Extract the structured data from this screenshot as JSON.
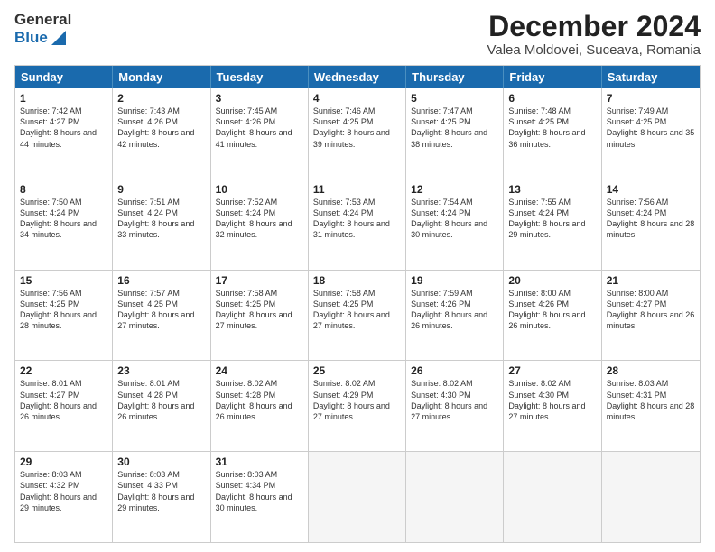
{
  "header": {
    "logo_general": "General",
    "logo_blue": "Blue",
    "month_title": "December 2024",
    "location": "Valea Moldovei, Suceava, Romania"
  },
  "days_of_week": [
    "Sunday",
    "Monday",
    "Tuesday",
    "Wednesday",
    "Thursday",
    "Friday",
    "Saturday"
  ],
  "weeks": [
    [
      {
        "day": 1,
        "sunrise": "7:42 AM",
        "sunset": "4:27 PM",
        "daylight": "8 hours and 44 minutes."
      },
      {
        "day": 2,
        "sunrise": "7:43 AM",
        "sunset": "4:26 PM",
        "daylight": "8 hours and 42 minutes."
      },
      {
        "day": 3,
        "sunrise": "7:45 AM",
        "sunset": "4:26 PM",
        "daylight": "8 hours and 41 minutes."
      },
      {
        "day": 4,
        "sunrise": "7:46 AM",
        "sunset": "4:25 PM",
        "daylight": "8 hours and 39 minutes."
      },
      {
        "day": 5,
        "sunrise": "7:47 AM",
        "sunset": "4:25 PM",
        "daylight": "8 hours and 38 minutes."
      },
      {
        "day": 6,
        "sunrise": "7:48 AM",
        "sunset": "4:25 PM",
        "daylight": "8 hours and 36 minutes."
      },
      {
        "day": 7,
        "sunrise": "7:49 AM",
        "sunset": "4:25 PM",
        "daylight": "8 hours and 35 minutes."
      }
    ],
    [
      {
        "day": 8,
        "sunrise": "7:50 AM",
        "sunset": "4:24 PM",
        "daylight": "8 hours and 34 minutes."
      },
      {
        "day": 9,
        "sunrise": "7:51 AM",
        "sunset": "4:24 PM",
        "daylight": "8 hours and 33 minutes."
      },
      {
        "day": 10,
        "sunrise": "7:52 AM",
        "sunset": "4:24 PM",
        "daylight": "8 hours and 32 minutes."
      },
      {
        "day": 11,
        "sunrise": "7:53 AM",
        "sunset": "4:24 PM",
        "daylight": "8 hours and 31 minutes."
      },
      {
        "day": 12,
        "sunrise": "7:54 AM",
        "sunset": "4:24 PM",
        "daylight": "8 hours and 30 minutes."
      },
      {
        "day": 13,
        "sunrise": "7:55 AM",
        "sunset": "4:24 PM",
        "daylight": "8 hours and 29 minutes."
      },
      {
        "day": 14,
        "sunrise": "7:56 AM",
        "sunset": "4:24 PM",
        "daylight": "8 hours and 28 minutes."
      }
    ],
    [
      {
        "day": 15,
        "sunrise": "7:56 AM",
        "sunset": "4:25 PM",
        "daylight": "8 hours and 28 minutes."
      },
      {
        "day": 16,
        "sunrise": "7:57 AM",
        "sunset": "4:25 PM",
        "daylight": "8 hours and 27 minutes."
      },
      {
        "day": 17,
        "sunrise": "7:58 AM",
        "sunset": "4:25 PM",
        "daylight": "8 hours and 27 minutes."
      },
      {
        "day": 18,
        "sunrise": "7:58 AM",
        "sunset": "4:25 PM",
        "daylight": "8 hours and 27 minutes."
      },
      {
        "day": 19,
        "sunrise": "7:59 AM",
        "sunset": "4:26 PM",
        "daylight": "8 hours and 26 minutes."
      },
      {
        "day": 20,
        "sunrise": "8:00 AM",
        "sunset": "4:26 PM",
        "daylight": "8 hours and 26 minutes."
      },
      {
        "day": 21,
        "sunrise": "8:00 AM",
        "sunset": "4:27 PM",
        "daylight": "8 hours and 26 minutes."
      }
    ],
    [
      {
        "day": 22,
        "sunrise": "8:01 AM",
        "sunset": "4:27 PM",
        "daylight": "8 hours and 26 minutes."
      },
      {
        "day": 23,
        "sunrise": "8:01 AM",
        "sunset": "4:28 PM",
        "daylight": "8 hours and 26 minutes."
      },
      {
        "day": 24,
        "sunrise": "8:02 AM",
        "sunset": "4:28 PM",
        "daylight": "8 hours and 26 minutes."
      },
      {
        "day": 25,
        "sunrise": "8:02 AM",
        "sunset": "4:29 PM",
        "daylight": "8 hours and 27 minutes."
      },
      {
        "day": 26,
        "sunrise": "8:02 AM",
        "sunset": "4:30 PM",
        "daylight": "8 hours and 27 minutes."
      },
      {
        "day": 27,
        "sunrise": "8:02 AM",
        "sunset": "4:30 PM",
        "daylight": "8 hours and 27 minutes."
      },
      {
        "day": 28,
        "sunrise": "8:03 AM",
        "sunset": "4:31 PM",
        "daylight": "8 hours and 28 minutes."
      }
    ],
    [
      {
        "day": 29,
        "sunrise": "8:03 AM",
        "sunset": "4:32 PM",
        "daylight": "8 hours and 29 minutes."
      },
      {
        "day": 30,
        "sunrise": "8:03 AM",
        "sunset": "4:33 PM",
        "daylight": "8 hours and 29 minutes."
      },
      {
        "day": 31,
        "sunrise": "8:03 AM",
        "sunset": "4:34 PM",
        "daylight": "8 hours and 30 minutes."
      },
      null,
      null,
      null,
      null
    ]
  ]
}
